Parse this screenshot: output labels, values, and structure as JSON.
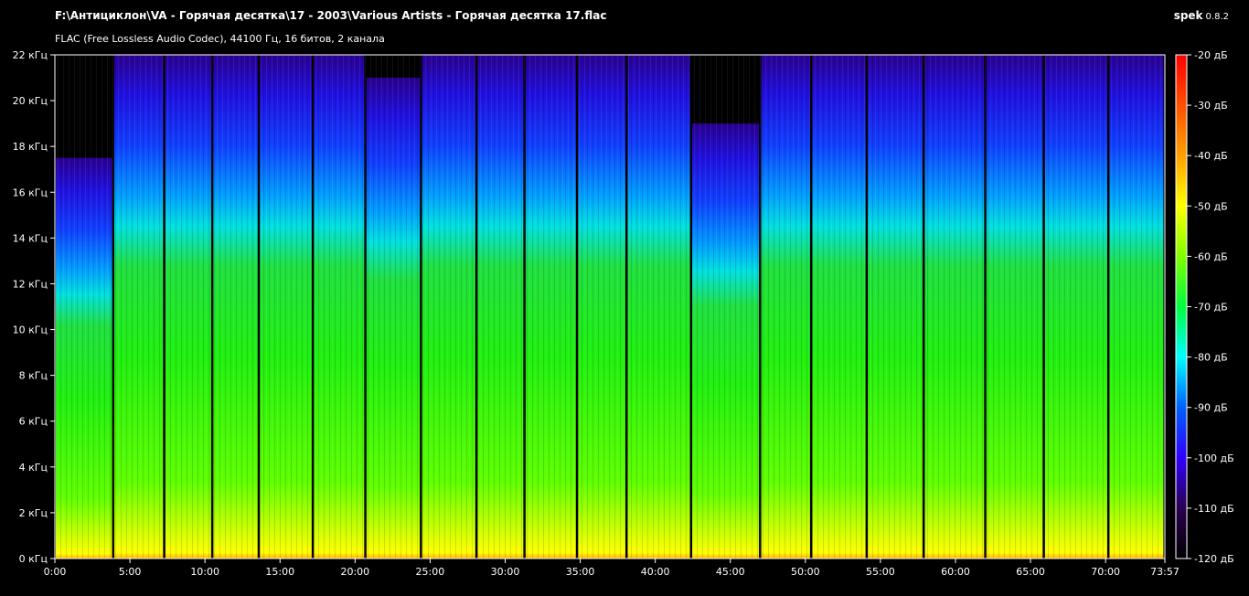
{
  "header": {
    "file_path": "F:\\Антициклон\\VA - Горячая десятка\\17 - 2003\\Various Artists - Горячая десятка 17.flac",
    "file_info": "FLAC (Free Lossless Audio Codec), 44100 Гц, 16 битов, 2 канала",
    "app_name": "spek",
    "app_version": "0.8.2"
  },
  "y_axis": {
    "unit": "кГц",
    "ticks": [
      "0 кГц",
      "2 кГц",
      "4 кГц",
      "6 кГц",
      "8 кГц",
      "10 кГц",
      "12 кГц",
      "14 кГц",
      "16 кГц",
      "18 кГц",
      "20 кГц",
      "22 кГц"
    ],
    "range_khz": [
      0,
      22
    ]
  },
  "x_axis": {
    "ticks": [
      "0:00",
      "5:00",
      "10:00",
      "15:00",
      "20:00",
      "25:00",
      "30:00",
      "35:00",
      "40:00",
      "45:00",
      "50:00",
      "55:00",
      "60:00",
      "65:00",
      "70:00",
      "73:57"
    ],
    "duration": "73:57"
  },
  "colorbar": {
    "labels": [
      "-20 дБ",
      "-30 дБ",
      "-40 дБ",
      "-50 дБ",
      "-60 дБ",
      "-70 дБ",
      "-80 дБ",
      "-90 дБ",
      "-100 дБ",
      "-110 дБ",
      "-120 дБ"
    ],
    "range_db": [
      -120,
      -20
    ],
    "colors": [
      "#000000",
      "#2b0050",
      "#3000ff",
      "#0080ff",
      "#00ffff",
      "#00ff40",
      "#80ff00",
      "#ffff00",
      "#ff8000",
      "#ff0000"
    ]
  },
  "tracks": [
    {
      "end_min": 3.9,
      "cutoff_khz": 17.5
    },
    {
      "end_min": 7.3,
      "cutoff_khz": 22
    },
    {
      "end_min": 10.5,
      "cutoff_khz": 22
    },
    {
      "end_min": 13.6,
      "cutoff_khz": 22
    },
    {
      "end_min": 17.2,
      "cutoff_khz": 22
    },
    {
      "end_min": 20.7,
      "cutoff_khz": 22
    },
    {
      "end_min": 24.4,
      "cutoff_khz": 21
    },
    {
      "end_min": 28.1,
      "cutoff_khz": 22
    },
    {
      "end_min": 31.3,
      "cutoff_khz": 22
    },
    {
      "end_min": 34.8,
      "cutoff_khz": 22
    },
    {
      "end_min": 38.1,
      "cutoff_khz": 22
    },
    {
      "end_min": 42.4,
      "cutoff_khz": 22
    },
    {
      "end_min": 47.0,
      "cutoff_khz": 19
    },
    {
      "end_min": 50.4,
      "cutoff_khz": 22
    },
    {
      "end_min": 54.1,
      "cutoff_khz": 22
    },
    {
      "end_min": 57.9,
      "cutoff_khz": 22
    },
    {
      "end_min": 62.0,
      "cutoff_khz": 22
    },
    {
      "end_min": 65.9,
      "cutoff_khz": 22
    },
    {
      "end_min": 70.2,
      "cutoff_khz": 22
    },
    {
      "end_min": 73.95,
      "cutoff_khz": 22
    }
  ]
}
